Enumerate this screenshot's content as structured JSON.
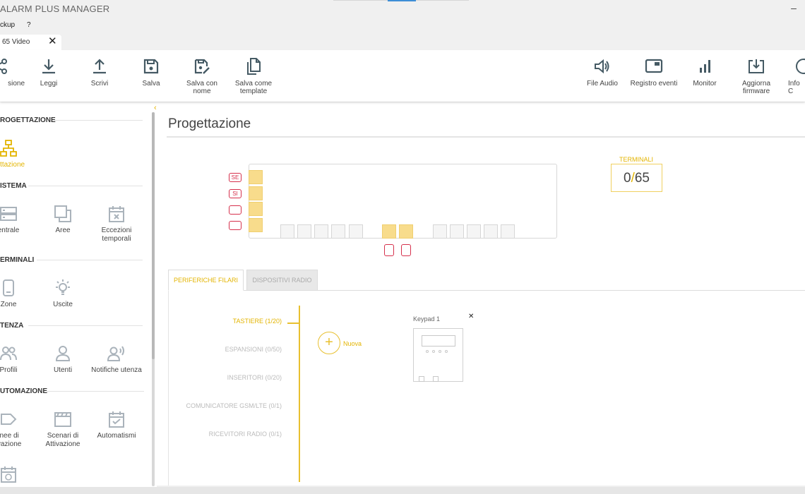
{
  "app": {
    "title": "ALARM PLUS MANAGER",
    "minimize_glyph": "–"
  },
  "menu": {
    "items": [
      "ckup",
      "?"
    ]
  },
  "doc_tab": {
    "label": "65 Video",
    "close_glyph": "✕"
  },
  "toolbar": {
    "left": [
      {
        "id": "connessione",
        "label": "sione",
        "icon": "share-icon"
      },
      {
        "id": "leggi",
        "label": "Leggi",
        "icon": "download-icon"
      },
      {
        "id": "scrivi",
        "label": "Scrivi",
        "icon": "upload-icon"
      },
      {
        "id": "salva",
        "label": "Salva",
        "icon": "save-icon"
      },
      {
        "id": "salva-nome",
        "label": "Salva con nome",
        "icon": "save-edit-icon"
      },
      {
        "id": "salva-template",
        "label": "Salva come template",
        "icon": "copy-icon"
      }
    ],
    "right": [
      {
        "id": "file-audio",
        "label": "File Audio",
        "icon": "speaker-icon"
      },
      {
        "id": "registro",
        "label": "Registro eventi",
        "icon": "log-icon"
      },
      {
        "id": "monitor",
        "label": "Monitor",
        "icon": "bar-chart-icon"
      },
      {
        "id": "firmware",
        "label": "Aggiorna firmware",
        "icon": "firmware-icon"
      },
      {
        "id": "info",
        "label": "Info C",
        "icon": "info-icon"
      }
    ]
  },
  "sidebar": {
    "collapse_glyph": "‹",
    "sections": [
      {
        "title": "ROGETTAZIONE",
        "items": [
          {
            "label": "gettazione",
            "icon": "network-icon",
            "active": true
          }
        ]
      },
      {
        "title": "ISTEMA",
        "items": [
          {
            "label": "entrale",
            "icon": "server-icon"
          },
          {
            "label": "Aree",
            "icon": "areas-icon"
          },
          {
            "label": "Eccezioni temporali",
            "icon": "calendar-x-icon"
          }
        ]
      },
      {
        "title": "ERMINALI",
        "items": [
          {
            "label": "Zone",
            "icon": "sensor-icon"
          },
          {
            "label": "Uscite",
            "icon": "bulb-icon"
          }
        ]
      },
      {
        "title": "TENZA",
        "items": [
          {
            "label": "Profili",
            "icon": "users-icon"
          },
          {
            "label": "Utenti",
            "icon": "user-icon"
          },
          {
            "label": "Notifiche utenza",
            "icon": "user-notify-icon"
          }
        ]
      },
      {
        "title": "UTOMAZIONE",
        "items": [
          {
            "label": "inee di ivazione",
            "icon": "tag-icon"
          },
          {
            "label": "Scenari di Attivazione",
            "icon": "clapper-icon"
          },
          {
            "label": "Automatismi",
            "icon": "calendar-check-icon"
          }
        ]
      }
    ]
  },
  "main": {
    "title": "Progettazione",
    "terminals": {
      "label": "TERMINALI",
      "used": "0",
      "slash": "/",
      "total": "65"
    },
    "board": {
      "side_tags": [
        "SE",
        "SI",
        "",
        ""
      ]
    },
    "tabs": [
      {
        "label": "PERIFERICHE FILARI",
        "active": true
      },
      {
        "label": "DISPOSITIVI RADIO",
        "active": false
      }
    ],
    "categories": [
      {
        "label": "TASTIERE (1/20)",
        "active": true
      },
      {
        "label": "ESPANSIONI (0/50)",
        "active": false
      },
      {
        "label": "INSERITORI (0/20)",
        "active": false
      },
      {
        "label": "COMUNICATORE GSM/LTE (0/1)",
        "active": false
      },
      {
        "label": "RICEVITORI RADIO (0/1)",
        "active": false
      }
    ],
    "new_button": {
      "glyph": "+",
      "label": "Nuova"
    },
    "device": {
      "title": "Keypad 1",
      "close_glyph": "✕"
    }
  },
  "colors": {
    "accent": "#e3b400",
    "slot_fill": "#f8dc8c",
    "port_red": "#d6304c"
  }
}
